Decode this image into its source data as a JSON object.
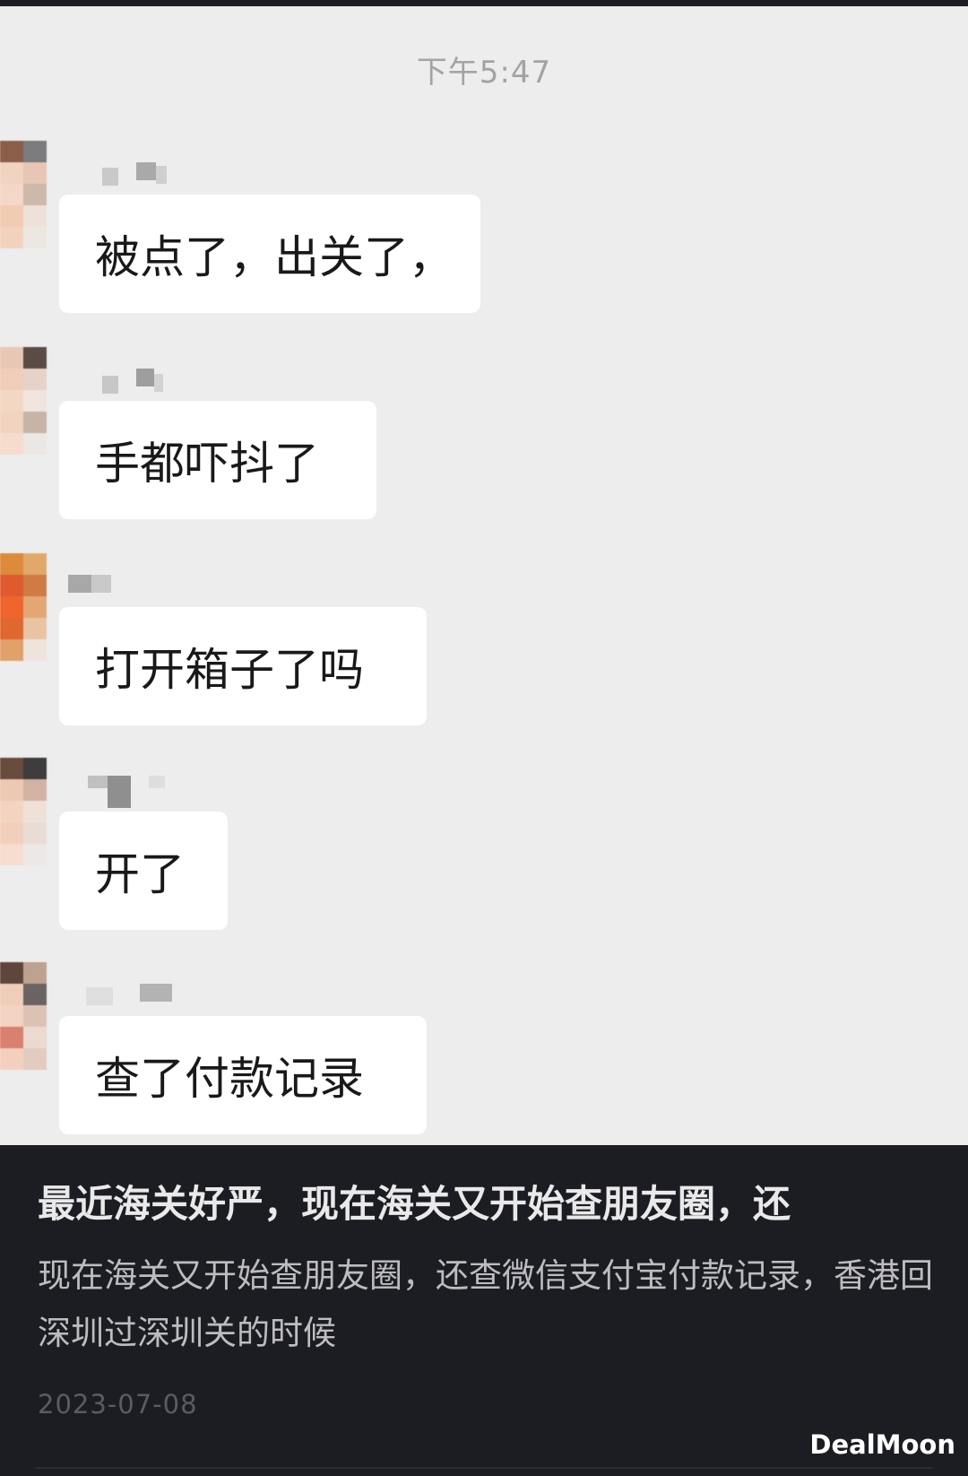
{
  "chat": {
    "timestamp": "下午5:47",
    "messages": [
      {
        "text": "被点了，出关了，"
      },
      {
        "text": "手都吓抖了"
      },
      {
        "text": "打开箱子了吗"
      },
      {
        "text": "开了"
      },
      {
        "text": "查了付款记录"
      }
    ]
  },
  "post": {
    "title": "最近海关好严，现在海关又开始查朋友圈，还",
    "body": "现在海关又开始查朋友圈，还查微信支付宝付款记录，香港回深圳过深圳关的时候",
    "date": "2023-07-08"
  },
  "watermark": "DealMoon",
  "colors": {
    "chat_background": "#ededed",
    "bubble": "#ffffff",
    "footer_background": "#1c1d22"
  }
}
